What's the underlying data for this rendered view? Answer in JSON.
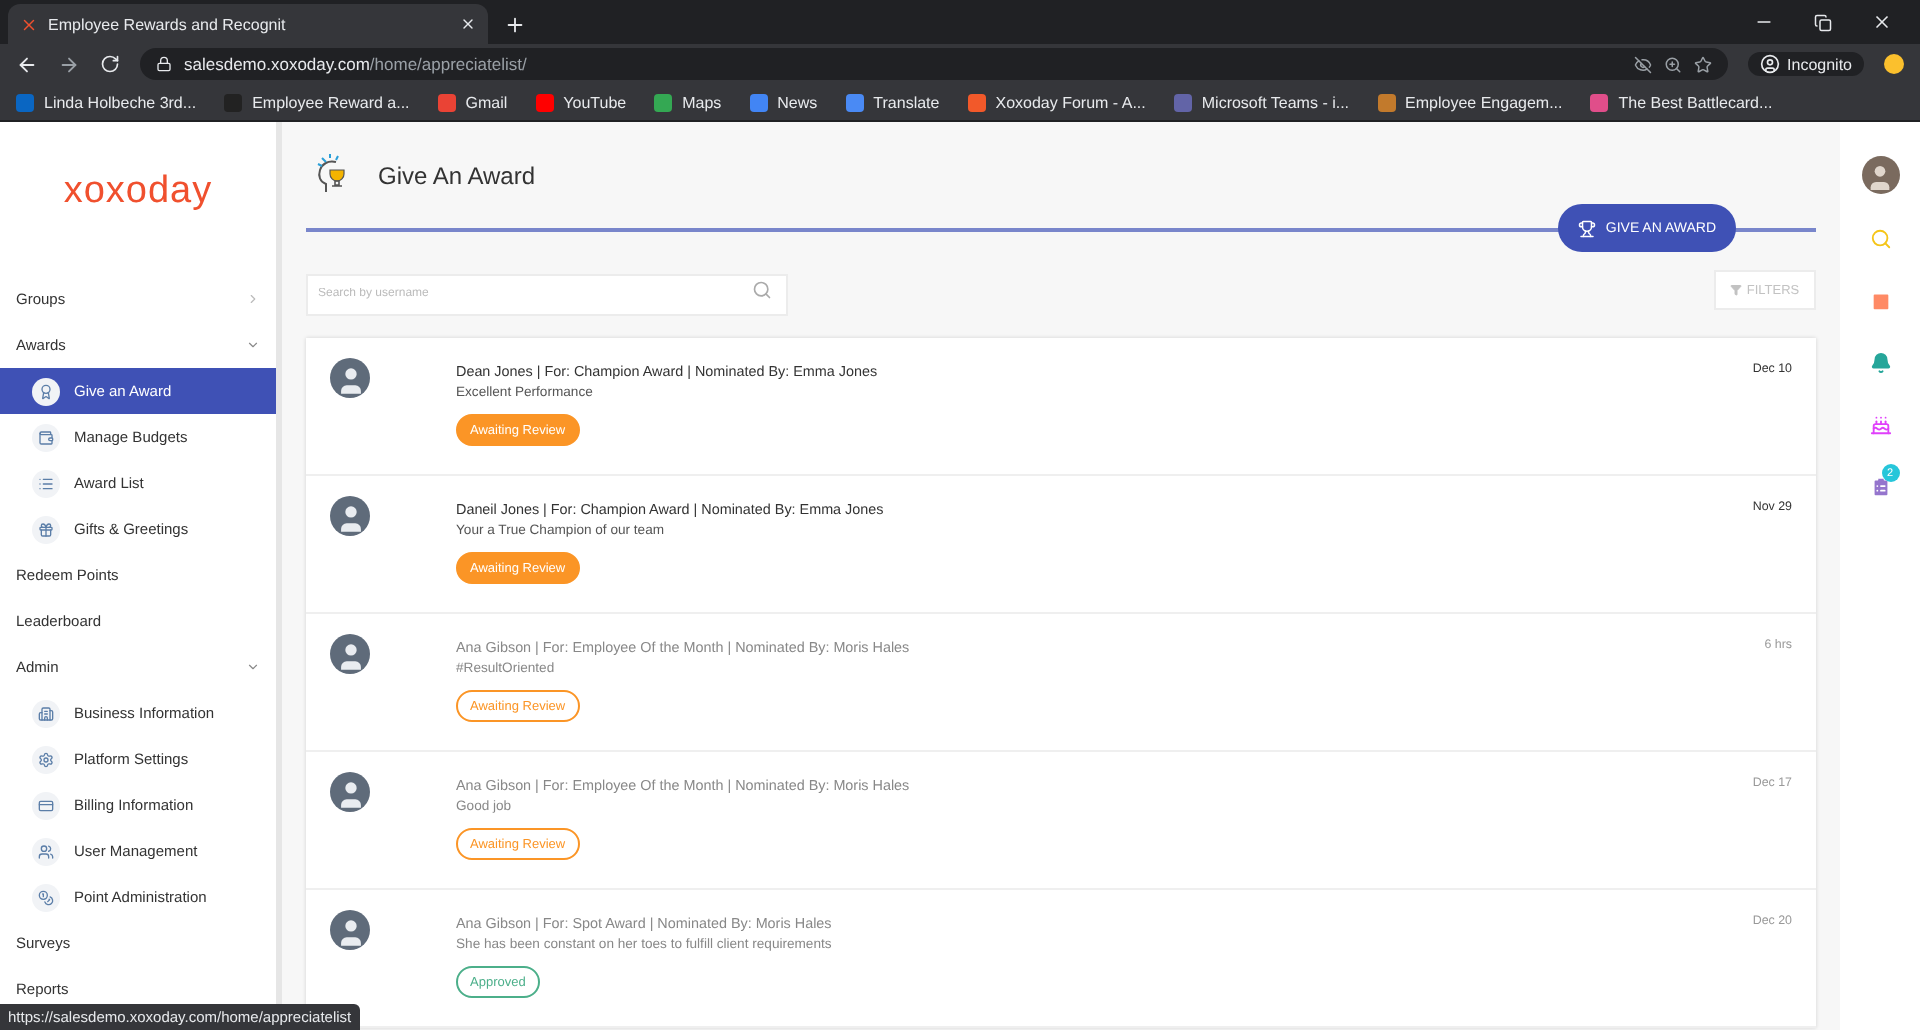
{
  "browser": {
    "tab_title": "Employee Rewards and Recognit",
    "url_domain": "salesdemo.xoxoday.com",
    "url_path": "/home/appreciatelist/",
    "profile": "Incognito",
    "bookmarks": [
      {
        "label": "Linda Holbeche 3rd...",
        "color": "#0a66c2"
      },
      {
        "label": "Employee Reward a...",
        "color": "#222222"
      },
      {
        "label": "Gmail",
        "color": "#ea4335"
      },
      {
        "label": "YouTube",
        "color": "#ff0000"
      },
      {
        "label": "Maps",
        "color": "#34a853"
      },
      {
        "label": "News",
        "color": "#4285f4"
      },
      {
        "label": "Translate",
        "color": "#4a8af4"
      },
      {
        "label": "Xoxoday Forum - A...",
        "color": "#f2592a"
      },
      {
        "label": "Microsoft Teams - i...",
        "color": "#6264a7"
      },
      {
        "label": "Employee Engagem...",
        "color": "#c27a2c"
      },
      {
        "label": "The Best Battlecard...",
        "color": "#e04e8a"
      }
    ]
  },
  "logo": "xoxoday",
  "sidebar": {
    "items": [
      {
        "label": "Groups",
        "expanded": false
      },
      {
        "label": "Awards",
        "expanded": true,
        "children": [
          {
            "label": "Give an Award",
            "selected": true
          },
          {
            "label": "Manage Budgets",
            "selected": false
          },
          {
            "label": "Award List",
            "selected": false
          },
          {
            "label": "Gifts & Greetings",
            "selected": false
          }
        ]
      },
      {
        "label": "Redeem Points"
      },
      {
        "label": "Leaderboard"
      },
      {
        "label": "Admin",
        "expanded": true,
        "children": [
          {
            "label": "Business Information",
            "selected": false
          },
          {
            "label": "Platform Settings",
            "selected": false
          },
          {
            "label": "Billing Information",
            "selected": false
          },
          {
            "label": "User Management",
            "selected": false
          },
          {
            "label": "Point Administration",
            "selected": false
          }
        ]
      },
      {
        "label": "Surveys"
      },
      {
        "label": "Reports"
      }
    ]
  },
  "page": {
    "title": "Give An Award",
    "action_button": "GIVE AN AWARD",
    "search": {
      "placeholder": "Search by username"
    },
    "filters_button": "FILTERS"
  },
  "awards": [
    {
      "title": "Dean Jones | For: Champion Award | Nominated By: Emma Jones",
      "message": "Excellent Performance",
      "status": "Awaiting Review",
      "kind": "awaiting",
      "unread": true,
      "date": "Dec 10"
    },
    {
      "title": "Daneil Jones | For: Champion Award | Nominated By: Emma Jones",
      "message": "Your a True Champion of our team",
      "status": "Awaiting Review",
      "kind": "awaiting",
      "unread": true,
      "date": "Nov 29"
    },
    {
      "title": "Ana Gibson | For: Employee Of the Month | Nominated By: Moris Hales",
      "message": "#ResultOriented",
      "status": "Awaiting Review",
      "kind": "awaiting",
      "unread": false,
      "date": "6 hrs"
    },
    {
      "title": "Ana Gibson | For: Employee Of the Month | Nominated By: Moris Hales",
      "message": "Good job",
      "status": "Awaiting Review",
      "kind": "awaiting",
      "unread": false,
      "date": "Dec 17"
    },
    {
      "title": "Ana Gibson | For: Spot Award | Nominated By: Moris Hales",
      "message": "She has been constant on her toes to fulfill client requirements",
      "status": "Approved",
      "kind": "approved",
      "unread": false,
      "date": "Dec 20"
    }
  ],
  "rail": {
    "notification_count": "2"
  },
  "status_url": "https://salesdemo.xoxoday.com/home/appreciatelist"
}
